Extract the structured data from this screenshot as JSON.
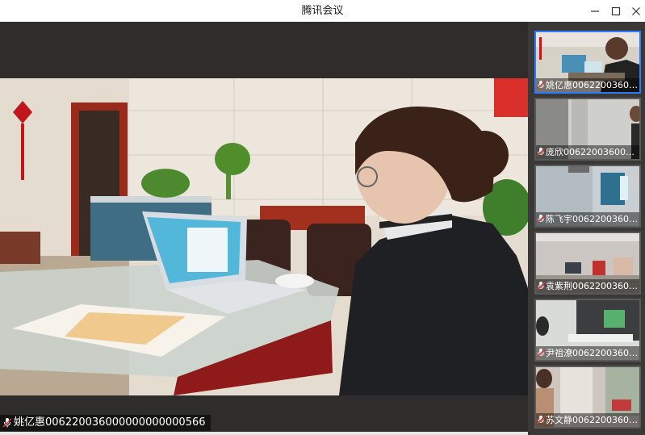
{
  "window": {
    "title": "腾讯会议"
  },
  "main_video": {
    "speaker_name": "姚亿惠006220036000000000000566"
  },
  "participants": [
    {
      "name": "姚亿惠0062200360000..."
    },
    {
      "name": "庞欣0062200360000000..."
    },
    {
      "name": "陈飞宇0062200360000..."
    },
    {
      "name": "袁紫荆0062200360000..."
    },
    {
      "name": "尹祖潦0062200360000..."
    },
    {
      "name": "苏文静0062200360000..."
    }
  ],
  "icons": {
    "minimize": "minimize-icon",
    "maximize": "maximize-icon",
    "close": "close-icon",
    "mic": "mic-muted-icon"
  },
  "colors": {
    "accent": "#2f7bff",
    "stage": "#2e2d2b",
    "sidebar": "#3a3938"
  }
}
